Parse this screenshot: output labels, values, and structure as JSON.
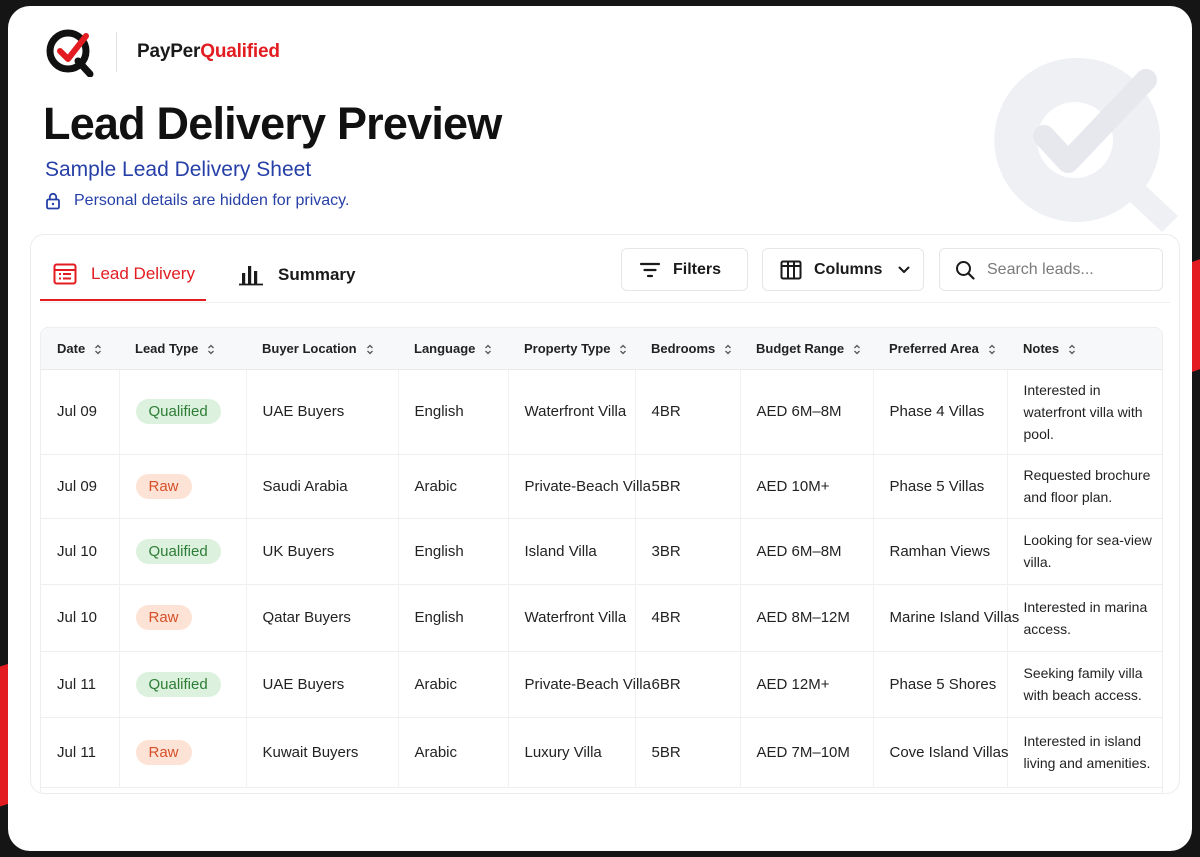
{
  "brand": {
    "name_part1": "PayPer",
    "name_part2": "Qualified",
    "accent": "#e21c21",
    "logo_icon": "checkmark-q-logo-icon"
  },
  "header": {
    "title": "Lead Delivery Preview",
    "subtitle": "Sample Lead Delivery Sheet",
    "privacy_note": "Personal details are hidden for privacy.",
    "privacy_icon": "lock-icon"
  },
  "tabs": [
    {
      "label": "Lead Delivery",
      "icon": "spreadsheet-icon",
      "active": true
    },
    {
      "label": "Summary",
      "icon": "bar-chart-icon",
      "active": false
    }
  ],
  "toolbar": {
    "filters_label": "Filters",
    "columns_label": "Columns",
    "search_placeholder": "Search leads...",
    "search_value": ""
  },
  "table": {
    "columns": [
      "Date",
      "Lead Type",
      "Buyer Location",
      "Language",
      "Property Type",
      "Bedrooms",
      "Budget Range",
      "Preferred Area",
      "Notes"
    ],
    "rows": [
      [
        "Jul 09",
        "Qualified",
        "UAE Buyers",
        "English",
        "Waterfront Villa",
        "4BR",
        "AED 6M–8M",
        "Phase 4 Villas",
        "Interested in waterfront villa with pool."
      ],
      [
        "Jul 09",
        "Raw",
        "Saudi Arabia",
        "Arabic",
        "Private-Beach Villa",
        "5BR",
        "AED 10M+",
        "Phase 5 Villas",
        "Requested brochure and floor plan."
      ],
      [
        "Jul 10",
        "Qualified",
        "UK Buyers",
        "English",
        "Island Villa",
        "3BR",
        "AED 6M–8M",
        "Ramhan Views",
        "Looking for sea-view villa."
      ],
      [
        "Jul 10",
        "Raw",
        "Qatar Buyers",
        "English",
        "Waterfront Villa",
        "4BR",
        "AED 8M–12M",
        "Marine Island Villas",
        "Interested in marina access."
      ],
      [
        "Jul 11",
        "Qualified",
        "UAE Buyers",
        "Arabic",
        "Private-Beach Villa",
        "6BR",
        "AED 12M+",
        "Phase 5 Shores",
        "Seeking family villa with beach access."
      ],
      [
        "Jul 11",
        "Raw",
        "Kuwait Buyers",
        "Arabic",
        "Luxury Villa",
        "5BR",
        "AED 7M–10M",
        "Cove Island Villas",
        "Interested in island living and amenities."
      ]
    ]
  },
  "colors": {
    "qualified_bg": "#dcf1de",
    "qualified_text": "#2e7d36",
    "raw_bg": "#fde3d5",
    "raw_text": "#d6502a",
    "link_blue": "#2740a8"
  }
}
